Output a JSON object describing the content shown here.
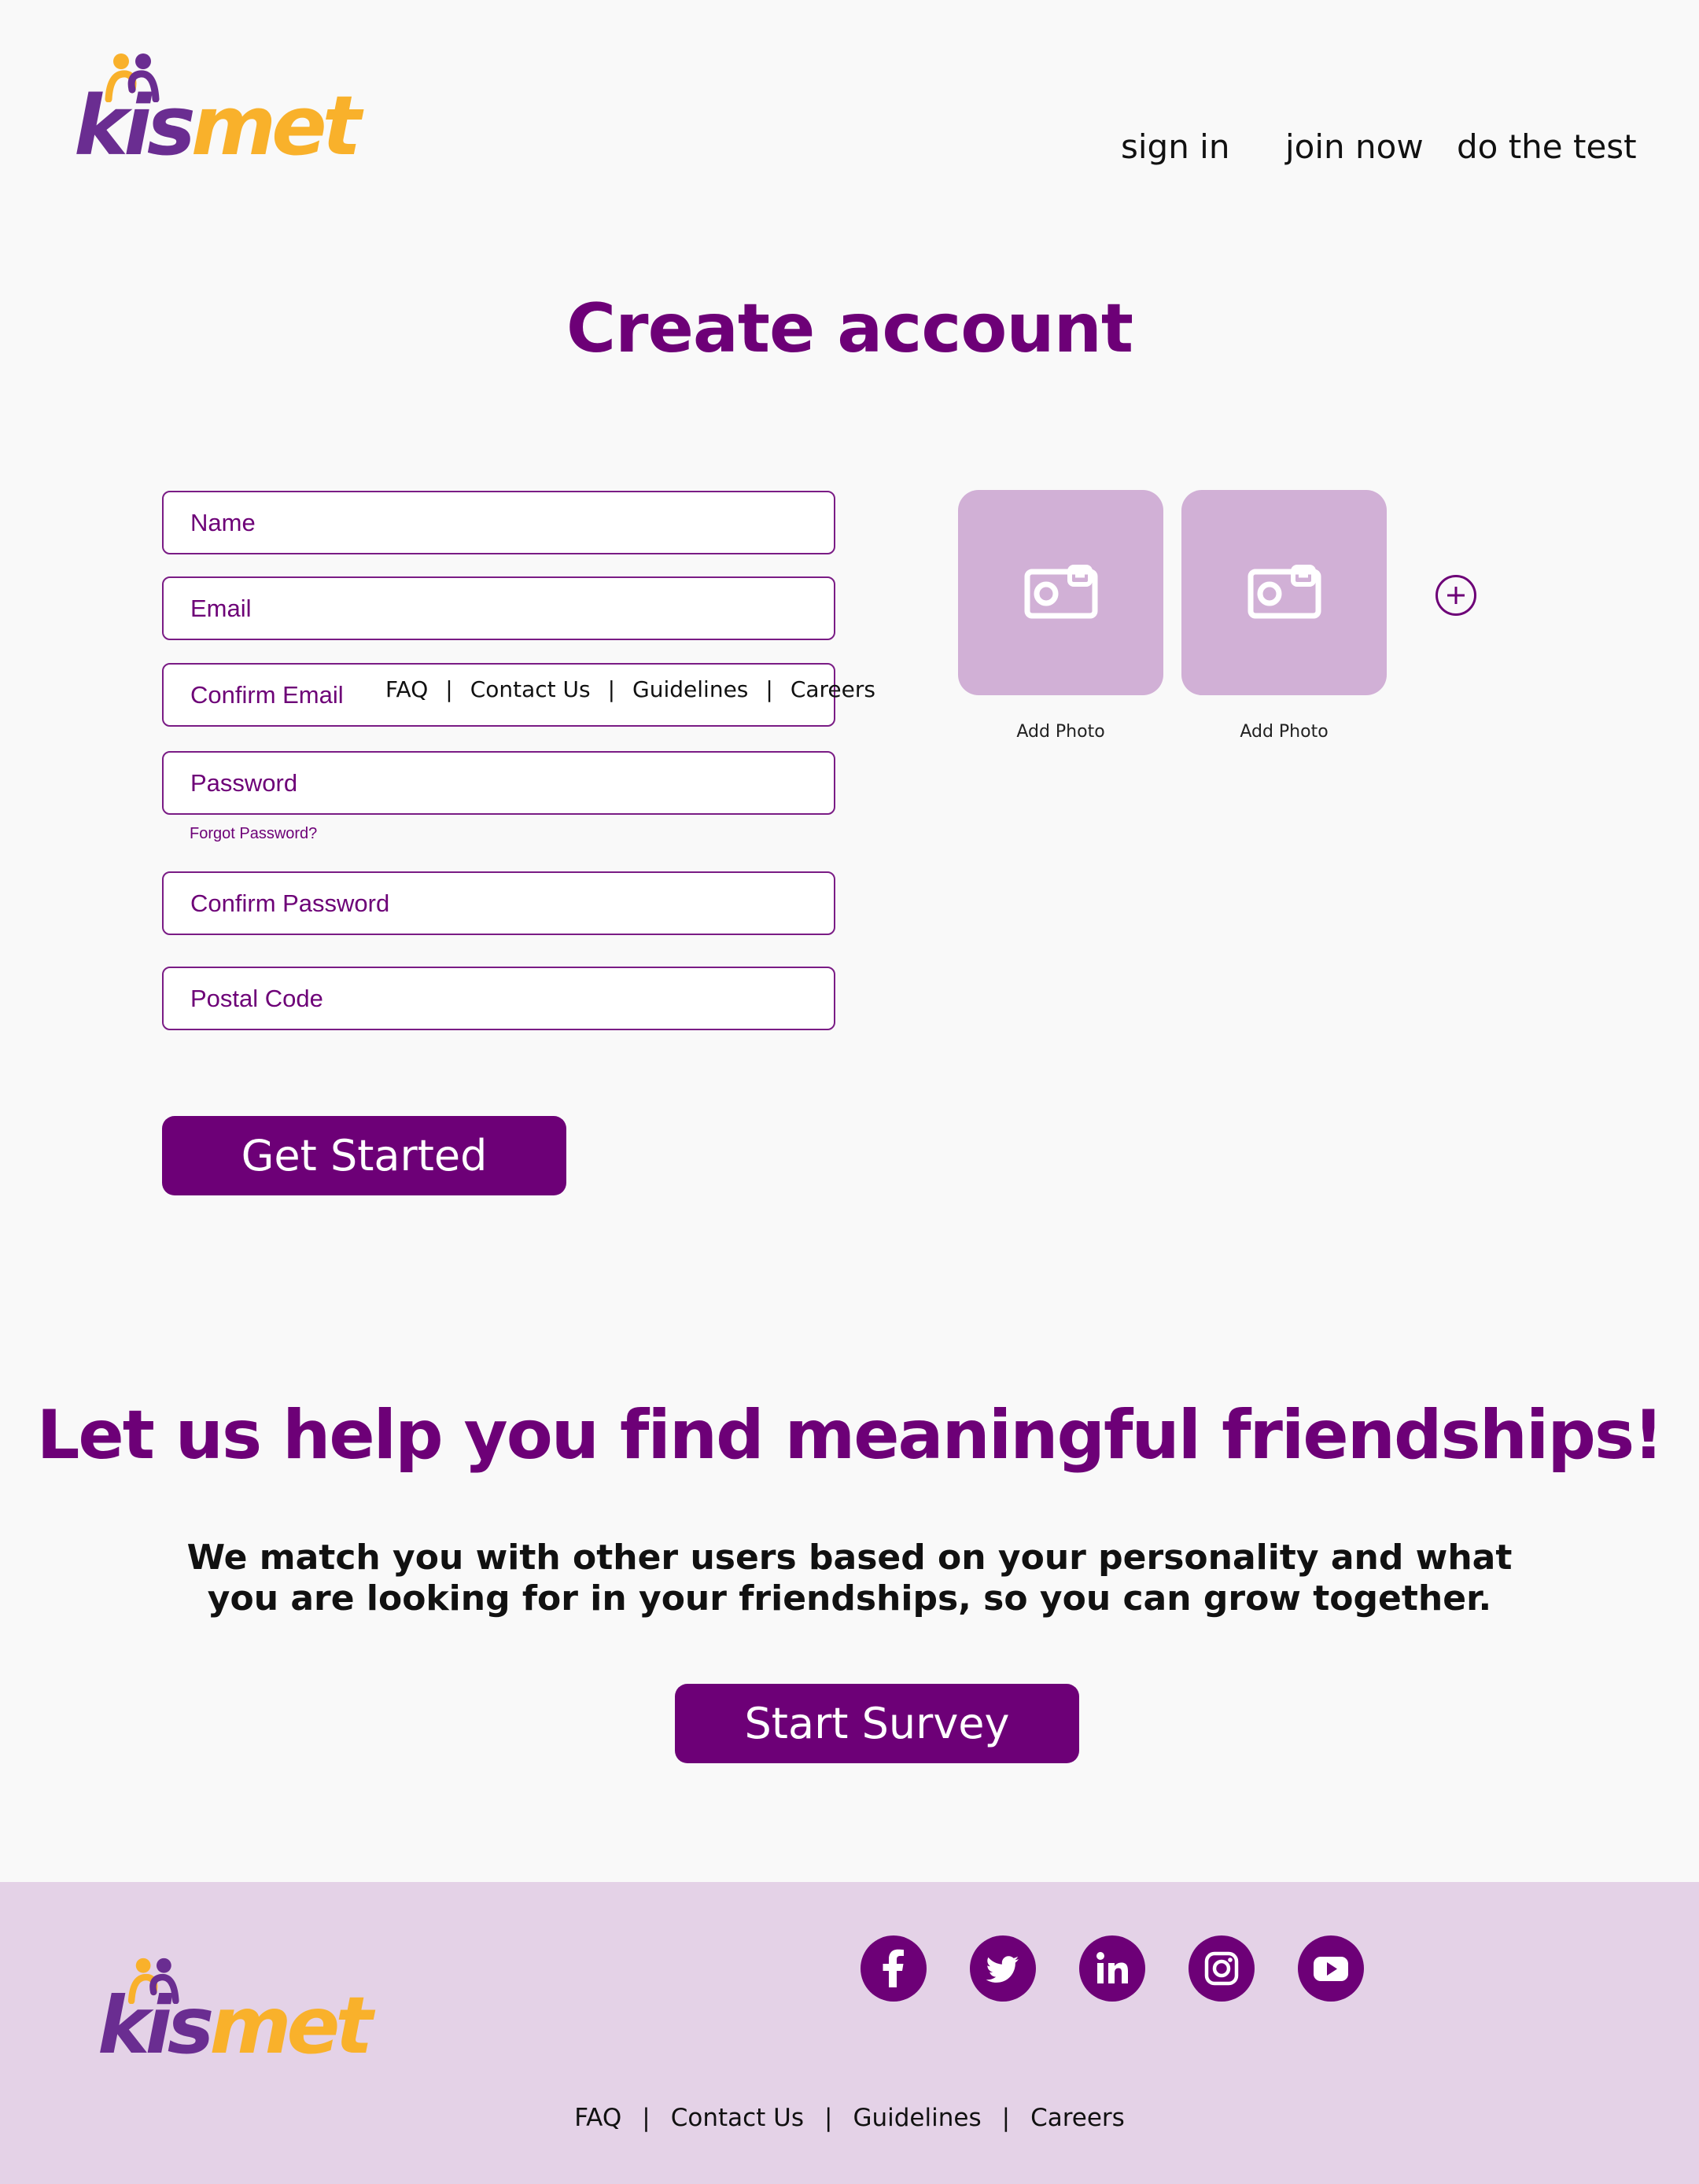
{
  "header": {
    "logo": {
      "part1": "kis",
      "part2": "met"
    },
    "nav": [
      {
        "label": "sign in"
      },
      {
        "label": "join now"
      },
      {
        "label": "do the test"
      }
    ]
  },
  "form": {
    "title": "Create account",
    "fields": [
      {
        "placeholder": "Name"
      },
      {
        "placeholder": "Email"
      },
      {
        "placeholder": "Confirm Email"
      },
      {
        "placeholder": "Password"
      },
      {
        "placeholder": "Confirm Password"
      },
      {
        "placeholder": "Postal Code"
      }
    ],
    "forgot_password": "Forgot Password?",
    "submit_label": "Get Started",
    "overlay_links": [
      "FAQ",
      "|",
      "Contact Us",
      "|",
      "Guidelines",
      "|",
      "Careers"
    ]
  },
  "photos": {
    "slots": [
      {
        "label": "Add Photo"
      },
      {
        "label": "Add Photo"
      }
    ]
  },
  "promo": {
    "heading": "Let us help you find meaningful friendships!",
    "description": "We match you with other users based on your personality and what you are looking for in your friendships, so you can grow together.",
    "button_label": "Start Survey"
  },
  "footer": {
    "logo": {
      "part1": "kis",
      "part2": "met"
    },
    "social": [
      "facebook-icon",
      "twitter-icon",
      "linkedin-icon",
      "instagram-icon",
      "youtube-icon"
    ],
    "links": [
      "FAQ",
      "Contact Us",
      "Guidelines",
      "Careers"
    ],
    "separator": "|"
  },
  "colors": {
    "brand_purple": "#6d0077",
    "logo_purple": "#6a2d91",
    "logo_yellow": "#f9b12b",
    "photo_bg": "#d1b0d6",
    "footer_bg": "#e4d2e7"
  }
}
